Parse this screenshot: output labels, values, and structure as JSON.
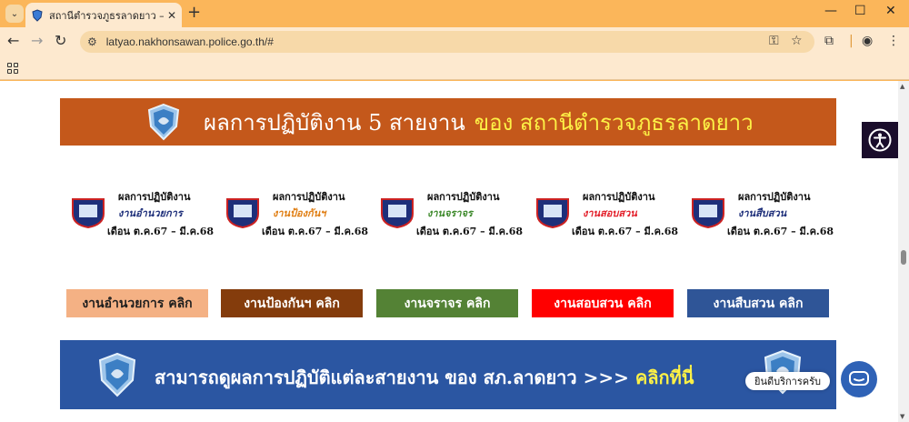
{
  "browser": {
    "tab_title": "สถานีตำรวจภูธรลาดยาว – LATYAO",
    "url": "latyao.nakhonsawan.police.go.th/#"
  },
  "icons": {
    "tab_list": "chevron-down-icon",
    "back": "arrow-left-icon",
    "forward": "arrow-right-icon",
    "reload": "reload-icon",
    "site_info": "tune-icon",
    "password_key": "key-icon",
    "bookmark": "star-icon",
    "extensions": "puzzle-icon",
    "profile": "profile-icon",
    "menu": "kebab-menu-icon",
    "apps": "apps-grid-icon",
    "accessibility": "accessibility-icon",
    "chat": "chat-icon"
  },
  "header_banner": {
    "text_white": "ผลการปฏิบัติงาน 5 สายงาน",
    "text_yellow": "ของ สถานีตำรวจภูธรลาดยาว"
  },
  "cards": [
    {
      "line1": "ผลการปฏิบัติงาน",
      "line2": "งานอำนวยการ",
      "line3": "เดือน ต.ค.67 – มี.ค.68",
      "line2_color": "#1e2f7a"
    },
    {
      "line1": "ผลการปฏิบัติงาน",
      "line2": "งานป้องกันฯ",
      "line3": "เดือน ต.ค.67 – มี.ค.68",
      "line2_color": "#e07e13"
    },
    {
      "line1": "ผลการปฏิบัติงาน",
      "line2": "งานจราจร",
      "line3": "เดือน ต.ค.67 – มี.ค.68",
      "line2_color": "#3e8a2c"
    },
    {
      "line1": "ผลการปฏิบัติงาน",
      "line2": "งานสอบสวน",
      "line3": "เดือน ต.ค.67 – มี.ค.68",
      "line2_color": "#e3202b"
    },
    {
      "line1": "ผลการปฏิบัติงาน",
      "line2": "งานสืบสวน",
      "line3": "เดือน ต.ค.67 – มี.ค.68",
      "line2_color": "#1e2f7a"
    }
  ],
  "buttons": [
    {
      "label": "งานอำนวยการ คลิก",
      "bg": "#f4b184",
      "fg": "#1e1e1e"
    },
    {
      "label": "งานป้องกันฯ คลิก",
      "bg": "#843c0c",
      "fg": "#ffffff"
    },
    {
      "label": "งานจราจร คลิก",
      "bg": "#548235",
      "fg": "#ffffff"
    },
    {
      "label": "งานสอบสวน คลิก",
      "bg": "#ff0000",
      "fg": "#ffffff"
    },
    {
      "label": "งานสืบสวน คลิก",
      "bg": "#2f5597",
      "fg": "#ffffff"
    }
  ],
  "bottom_banner": {
    "text": "สามารถดูผลการปฏิบัติแต่ละสายงาน ของ สภ.ลาดยาว >>>",
    "highlight": "คลิกที่นี่"
  },
  "chat": {
    "tooltip": "ยินดีบริการครับ"
  },
  "colors": {
    "header_banner_bg": "#c4581b",
    "bottom_banner_bg": "#2b56a2",
    "highlight_yellow": "#fdf146",
    "browser_frame": "#fbb65a"
  }
}
